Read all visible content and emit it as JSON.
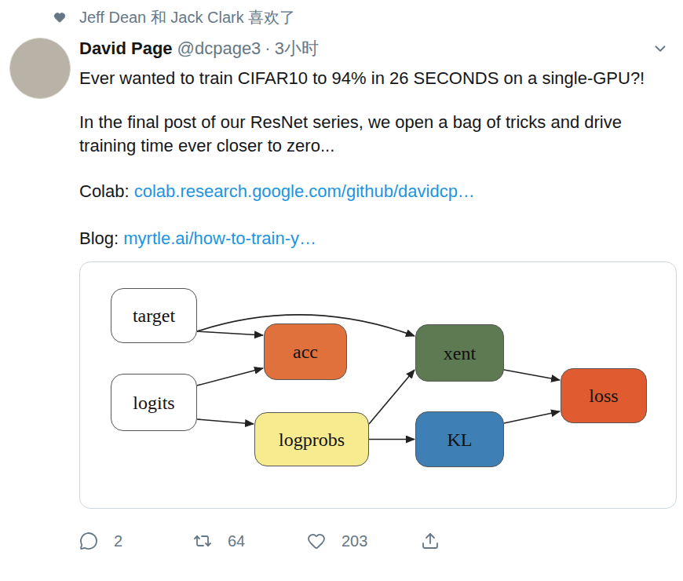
{
  "social_context": {
    "text": "Jeff Dean 和 Jack Clark 喜欢了"
  },
  "author": {
    "name": "David Page",
    "handle": "@dcpage3",
    "separator": "·",
    "time": "3小时"
  },
  "tweet": {
    "paragraphs": [
      "Ever wanted to train CIFAR10 to 94% in 26 SECONDS on a single-GPU?!",
      "In the final post of our ResNet series, we open a bag of tricks and drive training time ever closer to zero..."
    ],
    "links": [
      {
        "label": "Colab:",
        "link": "colab.research.google.com/github/davidcp…"
      },
      {
        "label": "Blog:",
        "link": "myrtle.ai/how-to-train-y…"
      }
    ]
  },
  "diagram": {
    "nodes": [
      {
        "label": "target",
        "color": "#ffffff"
      },
      {
        "label": "logits",
        "color": "#ffffff"
      },
      {
        "label": "acc",
        "color": "#e0713d"
      },
      {
        "label": "logprobs",
        "color": "#f7eb8f"
      },
      {
        "label": "xent",
        "color": "#5d7a52"
      },
      {
        "label": "KL",
        "color": "#3e80b5"
      },
      {
        "label": "loss",
        "color": "#e05c30"
      }
    ],
    "edges": [
      {
        "from": "target",
        "to": "acc"
      },
      {
        "from": "target",
        "to": "xent"
      },
      {
        "from": "logits",
        "to": "acc"
      },
      {
        "from": "logits",
        "to": "logprobs"
      },
      {
        "from": "logprobs",
        "to": "xent"
      },
      {
        "from": "logprobs",
        "to": "KL"
      },
      {
        "from": "xent",
        "to": "loss"
      },
      {
        "from": "KL",
        "to": "loss"
      }
    ]
  },
  "actions": [
    {
      "kind": "reply",
      "count": "2"
    },
    {
      "kind": "retweet",
      "count": "64"
    },
    {
      "kind": "like",
      "count": "203"
    },
    {
      "kind": "share"
    }
  ]
}
